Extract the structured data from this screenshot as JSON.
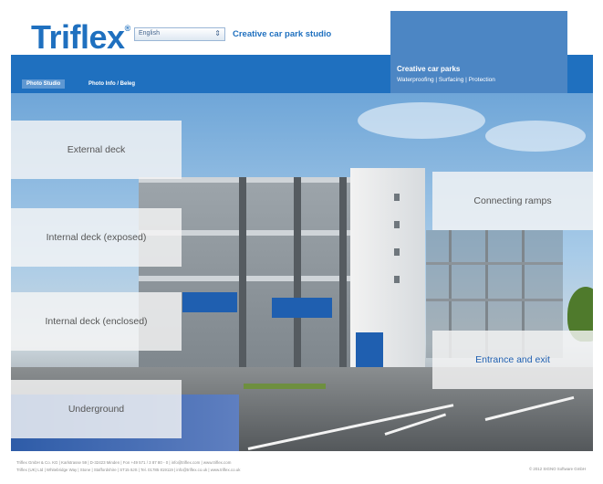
{
  "header": {
    "logo_text": "Triflex",
    "logo_mark": "®",
    "language_select": "English",
    "studio_title": "Creative car park studio"
  },
  "nav": {
    "tabs": [
      {
        "label": "Photo Studio",
        "active": true
      },
      {
        "label": "Photo Info / Beleg",
        "active": false
      }
    ]
  },
  "promo": {
    "title": "Creative car parks",
    "subtitle": "Waterproofing | Surfacing | Protection"
  },
  "zones": [
    {
      "label": "External deck"
    },
    {
      "label": "Internal deck (exposed)"
    },
    {
      "label": "Internal deck (enclosed)"
    },
    {
      "label": "Underground"
    },
    {
      "label": "Connecting ramps"
    },
    {
      "label": "Entrance and exit"
    }
  ],
  "footer": {
    "line1": "Triflex GmbH & Co. KG | Karlstrasse 59 | D-32423 Minden | Fon +49 571 / 3 87 80 - 0 | info@triflex.com | www.triflex.com",
    "line2": "Triflex (UK) Ltd | Whitebridge Way | Stone | Staffordshire | ST15 8JS | Tel. 01785 819119 | info@triflex.co.uk | www.triflex.co.uk",
    "copyright": "© 2012 SIGNO Software GmbH"
  },
  "colors": {
    "brand_blue": "#1f70bf",
    "promo_blue": "#4c86c4"
  }
}
